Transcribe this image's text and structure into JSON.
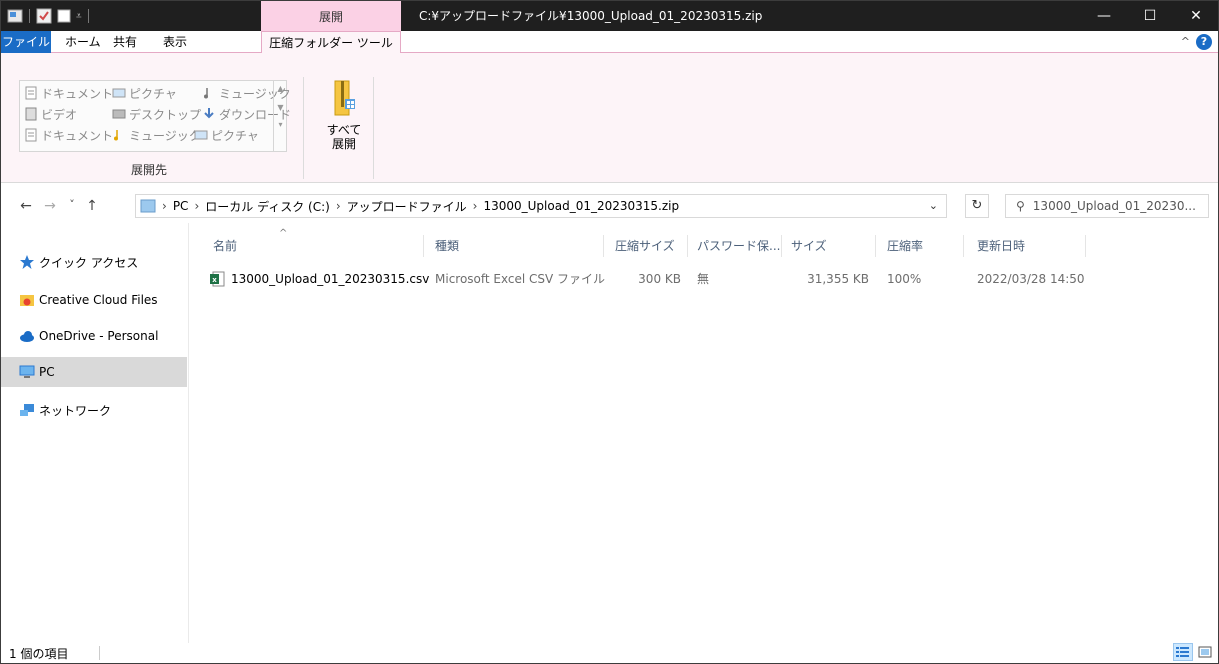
{
  "titlebar": {
    "context_tab_title": "展開",
    "window_title": "C:¥アップロードファイル¥13000_Upload_01_20230315.zip",
    "minimize": "—",
    "maximize": "☐",
    "close": "✕"
  },
  "tabs": {
    "file": "ファイル",
    "home": "ホーム",
    "share": "共有",
    "view": "表示",
    "compressed_tools": "圧縮フォルダー ツール",
    "help": "?",
    "collapse": "^"
  },
  "ribbon": {
    "destinations": [
      "ドキュメント",
      "ピクチャ",
      "ミュージック",
      "ビデオ",
      "デスクトップ",
      "ダウンロード",
      "ドキュメント",
      "ミュージック",
      "ピクチャ"
    ],
    "group_label": "展開先",
    "extract_all_line1": "すべて",
    "extract_all_line2": "展開"
  },
  "addressbar": {
    "back": "←",
    "forward": "→",
    "recent": "˅",
    "up": "↑",
    "segments": [
      "PC",
      "ローカル ディスク (C:)",
      "アップロードファイル",
      "13000_Upload_01_20230315.zip"
    ],
    "refresh": "↻",
    "search_value": "13000_Upload_01_20230..."
  },
  "navpane": {
    "items": [
      "クイック アクセス",
      "Creative Cloud Files",
      "OneDrive - Personal",
      "PC",
      "ネットワーク"
    ]
  },
  "filelist": {
    "columns": [
      "名前",
      "種類",
      "圧縮サイズ",
      "パスワード保...",
      "サイズ",
      "圧縮率",
      "更新日時"
    ],
    "rows": [
      {
        "name": "13000_Upload_01_20230315.csv",
        "type": "Microsoft Excel CSV ファイル",
        "compressed_size": "300 KB",
        "password": "無",
        "size": "31,355 KB",
        "ratio": "100%",
        "modified": "2022/03/28 14:50"
      }
    ]
  },
  "statusbar": {
    "count": "1 個の項目"
  },
  "colors": {
    "titlebar": "#1f1f1f",
    "file_tab": "#1a6cc6",
    "context_tab": "#fbd1e5",
    "ribbon_bg": "#fdf4f8",
    "selected_nav": "#d9d9d9"
  }
}
